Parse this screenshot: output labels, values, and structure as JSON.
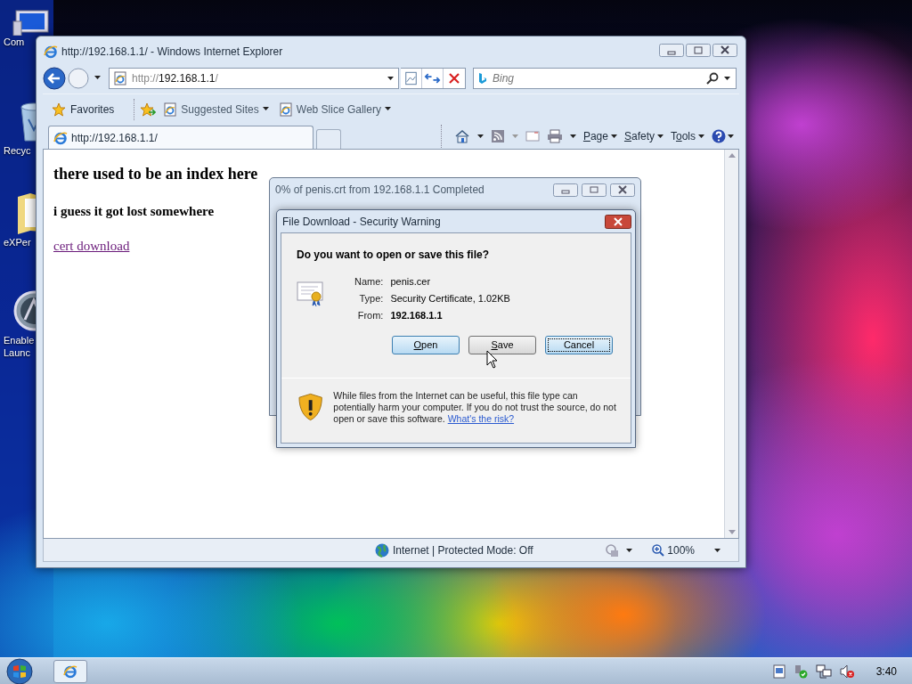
{
  "desktop_icons": [
    {
      "kind": "computer",
      "lines": [
        "Com"
      ]
    },
    {
      "kind": "recycle-bin",
      "lines": [
        "Recyc"
      ]
    },
    {
      "kind": "folder",
      "lines": [
        "eXPer"
      ]
    },
    {
      "kind": "app",
      "lines": [
        "Enable",
        "Launc"
      ]
    }
  ],
  "browser": {
    "title": "http://192.168.1.1/ - Windows Internet Explorer",
    "address": {
      "scheme": "http://",
      "host": "192.168.1.1",
      "path": "/"
    },
    "search": {
      "placeholder": "Bing"
    },
    "favorites": {
      "label": "Favorites",
      "links": [
        "Suggested Sites",
        "Web Slice Gallery"
      ]
    },
    "tab": {
      "label": "http://192.168.1.1/",
      "selected": true
    },
    "commands": [
      {
        "parts": [
          {
            "text": "P",
            "underlined": true
          },
          {
            "text": "age",
            "underlined": false
          }
        ]
      },
      {
        "parts": [
          {
            "text": "S",
            "underlined": true
          },
          {
            "text": "afety",
            "underlined": false
          }
        ]
      },
      {
        "parts": [
          {
            "text": "T",
            "underlined": false
          },
          {
            "text": "o",
            "underlined": true
          },
          {
            "text": "ols",
            "underlined": false
          }
        ]
      }
    ],
    "page": {
      "heading": "there used to be an index here",
      "subheading": "i guess it got lost somewhere",
      "link": {
        "label": "cert download",
        "visited": true
      }
    },
    "status": {
      "zone": "Internet | Protected Mode: Off",
      "zoom": "100%"
    }
  },
  "progress_dialog": {
    "title": "0% of penis.crt from 192.168.1.1 Completed"
  },
  "security_dialog": {
    "title": "File Download - Security Warning",
    "question": "Do you want to open or save this file?",
    "fields": [
      {
        "label": "Name:",
        "value": "penis.cer",
        "emphasis": false
      },
      {
        "label": "Type:",
        "value": "Security Certificate, 1.02KB",
        "emphasis": false
      },
      {
        "label": "From:",
        "value": "192.168.1.1",
        "emphasis": true
      }
    ],
    "buttons": [
      {
        "parts": [
          {
            "text": "O",
            "underlined": true
          },
          {
            "text": "pen",
            "underlined": false
          }
        ],
        "focused": false,
        "hovered": false
      },
      {
        "parts": [
          {
            "text": "S",
            "underlined": true
          },
          {
            "text": "ave",
            "underlined": false
          }
        ],
        "focused": false,
        "hovered": true
      },
      {
        "parts": [
          {
            "text": "Cancel",
            "underlined": false
          }
        ],
        "focused": true,
        "hovered": false
      }
    ],
    "warning": "While files from the Internet can be useful, this file type can potentially harm your computer. If you do not trust the source, do not open or save this software.",
    "risk_link": "What's the risk?"
  },
  "taskbar": {
    "clock": "3:40"
  }
}
